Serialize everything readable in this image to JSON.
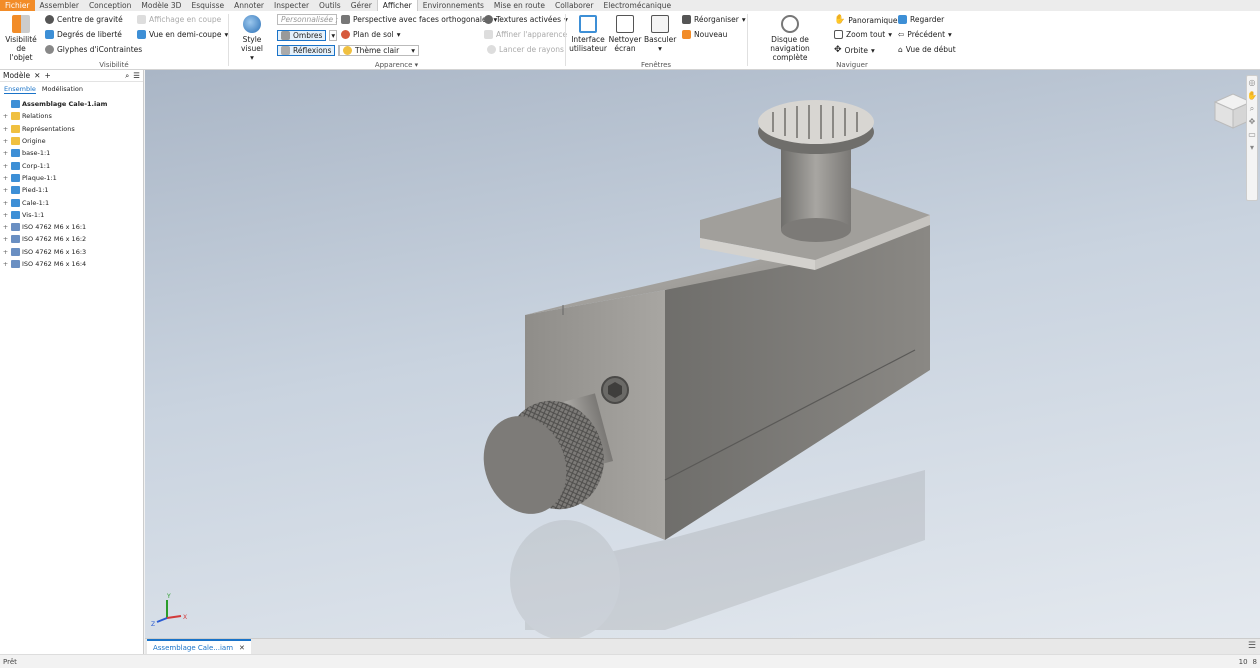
{
  "menu": [
    "Fichier",
    "Assembler",
    "Conception",
    "Modèle 3D",
    "Esquisse",
    "Annoter",
    "Inspecter",
    "Outils",
    "Gérer",
    "Afficher",
    "Environnements",
    "Mise en route",
    "Collaborer",
    "Electromécanique"
  ],
  "ribbon": {
    "visibilite": {
      "big_label_1": "Visibilité",
      "big_label_2": "de l'objet",
      "centre": "Centre de gravité",
      "degres": "Degrés de liberté",
      "glyphes": "Glyphes d'iContraintes",
      "affichage_coupe": "Affichage en coupe",
      "demi_coupe": "Vue en demi-coupe",
      "group": "Visibilité"
    },
    "apparence": {
      "style_visuel": "Style visuel",
      "personnalise": "Personnalisée ;",
      "perspective": "Perspective avec faces orthogonales",
      "textures": "Textures activées",
      "ombres": "Ombres",
      "plan_sol": "Plan de sol",
      "affiner": "Affiner l'apparence",
      "reflexions": "Réflexions",
      "theme": "Thème clair",
      "lancer": "Lancer de rayons",
      "group": "Apparence"
    },
    "fenetres": {
      "interface_1": "Interface",
      "interface_2": "utilisateur",
      "nettoyer_1": "Nettoyer",
      "nettoyer_2": "écran",
      "basculer": "Basculer",
      "reorganiser": "Réorganiser",
      "nouveau": "Nouveau",
      "group": "Fenêtres"
    },
    "naviguer": {
      "disque_1": "Disque de navigation",
      "disque_2": "complète",
      "panoramique": "Panoramique",
      "zoom": "Zoom tout",
      "orbite": "Orbite",
      "regarder": "Regarder",
      "precedent": "Précédent",
      "vue_debut": "Vue de début",
      "group": "Naviguer"
    }
  },
  "panel": {
    "title": "Modèle",
    "tab1": "Ensemble",
    "tab2": "Modélisation"
  },
  "tree": [
    {
      "label": "Assemblage Cale-1.iam",
      "icon": "assembly",
      "root": true
    },
    {
      "label": "Relations",
      "icon": "folder"
    },
    {
      "label": "Représentations",
      "icon": "folder"
    },
    {
      "label": "Origine",
      "icon": "folder"
    },
    {
      "label": "base-1:1",
      "icon": "part"
    },
    {
      "label": "Corp-1:1",
      "icon": "part"
    },
    {
      "label": "Plaque-1:1",
      "icon": "part"
    },
    {
      "label": "Pied-1:1",
      "icon": "part"
    },
    {
      "label": "Cale-1:1",
      "icon": "part"
    },
    {
      "label": "Vis-1:1",
      "icon": "part"
    },
    {
      "label": "ISO 4762 M6 x 16:1",
      "icon": "bolt"
    },
    {
      "label": "ISO 4762 M6 x 16:2",
      "icon": "bolt"
    },
    {
      "label": "ISO 4762 M6 x 16:3",
      "icon": "bolt"
    },
    {
      "label": "ISO 4762 M6 x 16:4",
      "icon": "bolt"
    }
  ],
  "doc_tab": "Assemblage Cale...iam",
  "status": {
    "text": "Prêt",
    "n1": "10",
    "n2": "8"
  },
  "colors": {
    "accent": "#1a73c8",
    "file": "#f28c28",
    "folder": "#f0c040",
    "part": "#3d8fd6"
  }
}
